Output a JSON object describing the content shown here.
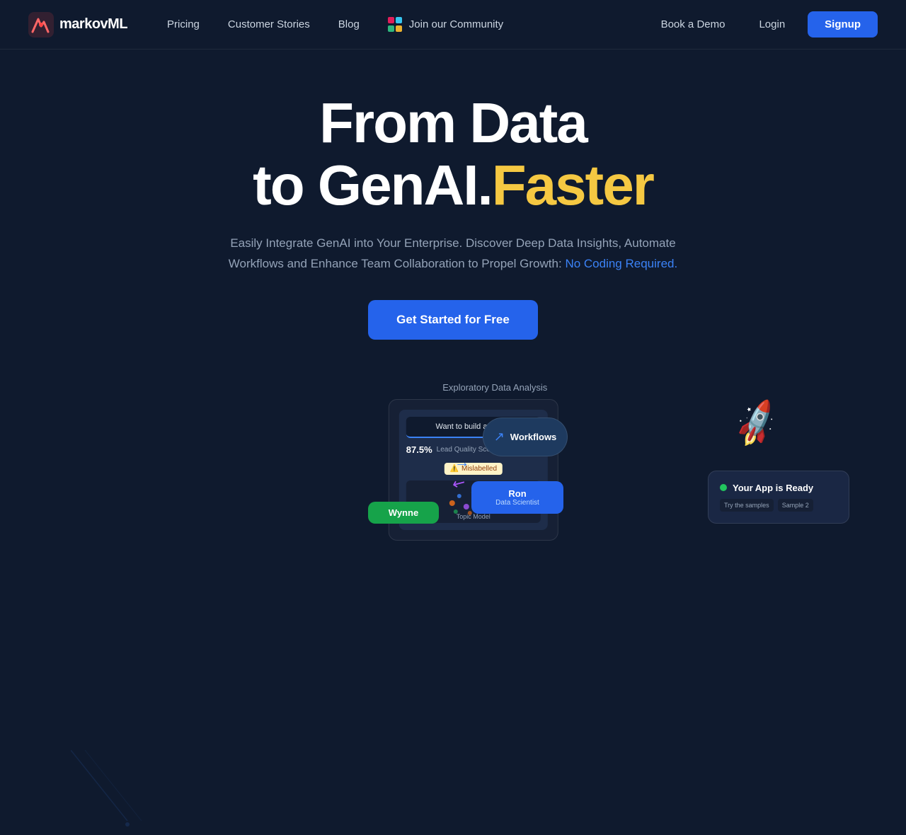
{
  "brand": {
    "name": "markovML",
    "logo_alt": "MarkovML Logo"
  },
  "nav": {
    "links_left": [
      {
        "label": "Pricing",
        "id": "pricing"
      },
      {
        "label": "Customer Stories",
        "id": "customer-stories"
      },
      {
        "label": "Blog",
        "id": "blog"
      },
      {
        "label": "Join our Community",
        "id": "community"
      }
    ],
    "links_right": [
      {
        "label": "Book a Demo",
        "id": "book-demo"
      },
      {
        "label": "Login",
        "id": "login"
      }
    ],
    "signup_label": "Signup"
  },
  "hero": {
    "title_line1": "From Data",
    "title_line2_prefix": "to GenAI.",
    "title_line2_accent": "Faster",
    "subtitle_main": "Easily Integrate GenAI into Your Enterprise. Discover Deep Data Insights, Automate Workflows and Enhance Team Collaboration to Propel Growth:",
    "subtitle_highlight": "No Coding Required.",
    "cta_label": "Get Started for Free"
  },
  "preview": {
    "eda_label": "Exploratory Data Analysis",
    "ask_label": "Want to build an app?",
    "stat_value": "87.5%",
    "stat_label": "Lead Quality Score",
    "mislabelled": "Mislabelled",
    "topic_model": "Topic Model",
    "workflow": "Workflows",
    "ron_name": "Ron",
    "ron_title": "Data Scientist",
    "wynne_name": "Wynne",
    "app_ready": "Your App is Ready"
  },
  "colors": {
    "accent_yellow": "#f5c842",
    "accent_blue": "#3b82f6",
    "cta_blue": "#2563eb",
    "bg_dark": "#0f1a2e"
  }
}
